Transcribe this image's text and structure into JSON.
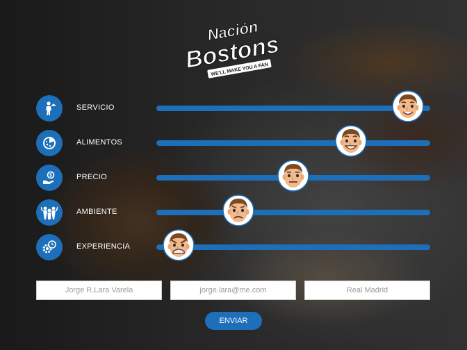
{
  "brand": {
    "line1": "Nación",
    "line2": "Bostons",
    "tagline": "WE'LL MAKE YOU A FAN"
  },
  "colors": {
    "accent": "#1c6fb8",
    "text": "#ffffff",
    "field_text": "#9a9a9a"
  },
  "ratings": [
    {
      "label": "SERVICIO",
      "icon": "waiter-icon",
      "value": 0.92,
      "mood": "happy"
    },
    {
      "label": "ALIMENTOS",
      "icon": "pizza-icon",
      "value": 0.71,
      "mood": "grin"
    },
    {
      "label": "PRECIO",
      "icon": "money-hand-icon",
      "value": 0.5,
      "mood": "neutral"
    },
    {
      "label": "AMBIENTE",
      "icon": "people-icon",
      "value": 0.3,
      "mood": "unhappy"
    },
    {
      "label": "EXPERIENCIA",
      "icon": "gear-clock-icon",
      "value": 0.08,
      "mood": "angry"
    }
  ],
  "form": {
    "name_value": "Jorge R.Lara Varela",
    "email_value": "jorge.lara@me.com",
    "team_value": "Real Madrid",
    "submit_label": "ENVIAR"
  }
}
